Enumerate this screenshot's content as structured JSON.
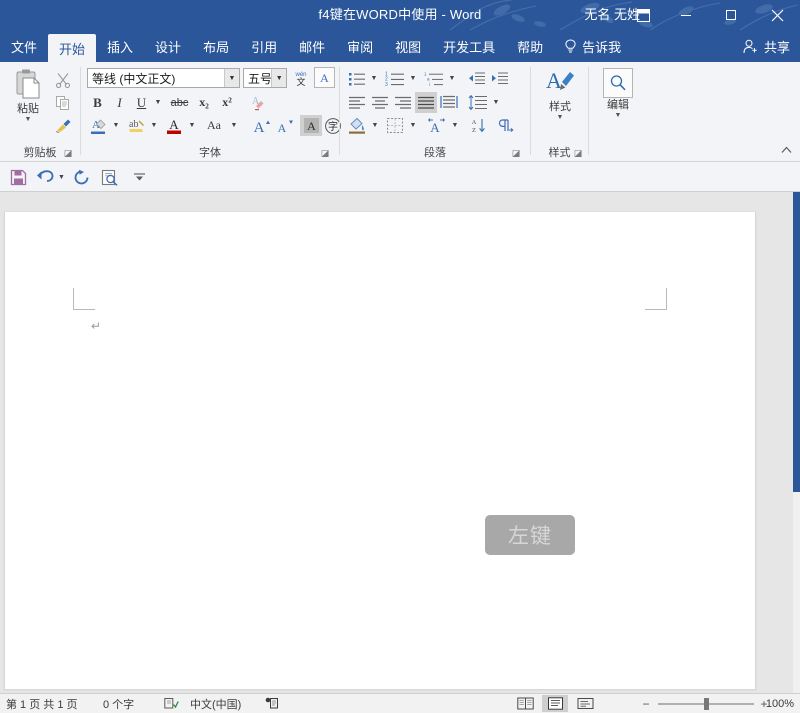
{
  "titlebar": {
    "document_title": "f4键在WORD中使用  -  Word",
    "user_name": "无名 无姓",
    "ribbon_display_options": "ribbon-display-options",
    "minimize": "最小化",
    "maximize": "最大化",
    "close": "关闭"
  },
  "tabs": [
    {
      "label": "文件",
      "active": false
    },
    {
      "label": "开始",
      "active": true
    },
    {
      "label": "插入",
      "active": false
    },
    {
      "label": "设计",
      "active": false
    },
    {
      "label": "布局",
      "active": false
    },
    {
      "label": "引用",
      "active": false
    },
    {
      "label": "邮件",
      "active": false
    },
    {
      "label": "审阅",
      "active": false
    },
    {
      "label": "视图",
      "active": false
    },
    {
      "label": "开发工具",
      "active": false
    },
    {
      "label": "帮助",
      "active": false
    }
  ],
  "tab_right": {
    "tell_me": "告诉我",
    "share": "共享"
  },
  "ribbon": {
    "groups": [
      {
        "name": "clipboard",
        "label": "剪贴板"
      },
      {
        "name": "font",
        "label": "字体"
      },
      {
        "name": "paragraph",
        "label": "段落"
      },
      {
        "name": "styles",
        "label": "样式"
      }
    ],
    "clipboard": {
      "paste_label": "粘贴",
      "cut_title": "剪切",
      "copy_title": "复制",
      "format_painter_title": "格式刷"
    },
    "font": {
      "font_name": "等线 (中文正文)",
      "font_size": "五号",
      "bold": "B",
      "italic": "I",
      "underline": "U",
      "strikethrough": "abc",
      "subscript": "x₂",
      "superscript": "x²",
      "clear_format_title": "清除所有格式",
      "phonetic_guide": "拼音指南",
      "char_border": "字符边框",
      "text_highlight": "文本突出显示颜色",
      "font_color": "字体颜色",
      "change_case": "Aa",
      "grow_font": "A",
      "shrink_font": "A",
      "text_effects": "A",
      "enclose_character": "带圈字符"
    },
    "paragraph": {
      "bullets": "项目符号",
      "numbering": "编号",
      "multilevel": "多级列表",
      "decrease_indent": "减少缩进量",
      "increase_indent": "增加缩进量",
      "align_left": "左对齐",
      "align_center": "居中",
      "align_right": "右对齐",
      "justify": "两端对齐",
      "distribute": "分散对齐",
      "line_spacing": "行和段落间距",
      "shading": "底纹",
      "borders": "边框",
      "text_adjust": "调整宽度",
      "sort": "排序",
      "show_marks": "显示编辑标记",
      "justify_active": true
    },
    "styles": {
      "styles_label": "样式",
      "editing_label": "编辑"
    },
    "collapse_ribbon": "折叠功能区"
  },
  "quick_access": [
    {
      "name": "save-icon",
      "title": "保存"
    },
    {
      "name": "undo-icon",
      "title": "撤消"
    },
    {
      "name": "redo-icon",
      "title": "恢复"
    },
    {
      "name": "print-preview-icon",
      "title": "打印预览和打印"
    },
    {
      "name": "customize-qat-icon",
      "title": "自定义快速访问工具栏"
    }
  ],
  "document": {
    "paragraph_mark": "↵",
    "click_overlay": "左键"
  },
  "statusbar": {
    "page_info": "第 1 页  共 1 页",
    "word_count": "0 个字",
    "proofing_icon": "校对",
    "language": "中文(中国)",
    "accessibility_icon": "辅助功能",
    "views": [
      {
        "name": "read-mode",
        "active": false
      },
      {
        "name": "print-layout",
        "active": true
      },
      {
        "name": "web-layout",
        "active": false
      }
    ],
    "zoom_out": "−",
    "zoom_in": "+",
    "zoom_level": "100%"
  },
  "colors": {
    "accent": "#2b579a",
    "ribbon_bg": "#f2f4f7",
    "workspace_bg": "#e6e6e6",
    "badge_bg": "#a8a8a8"
  }
}
